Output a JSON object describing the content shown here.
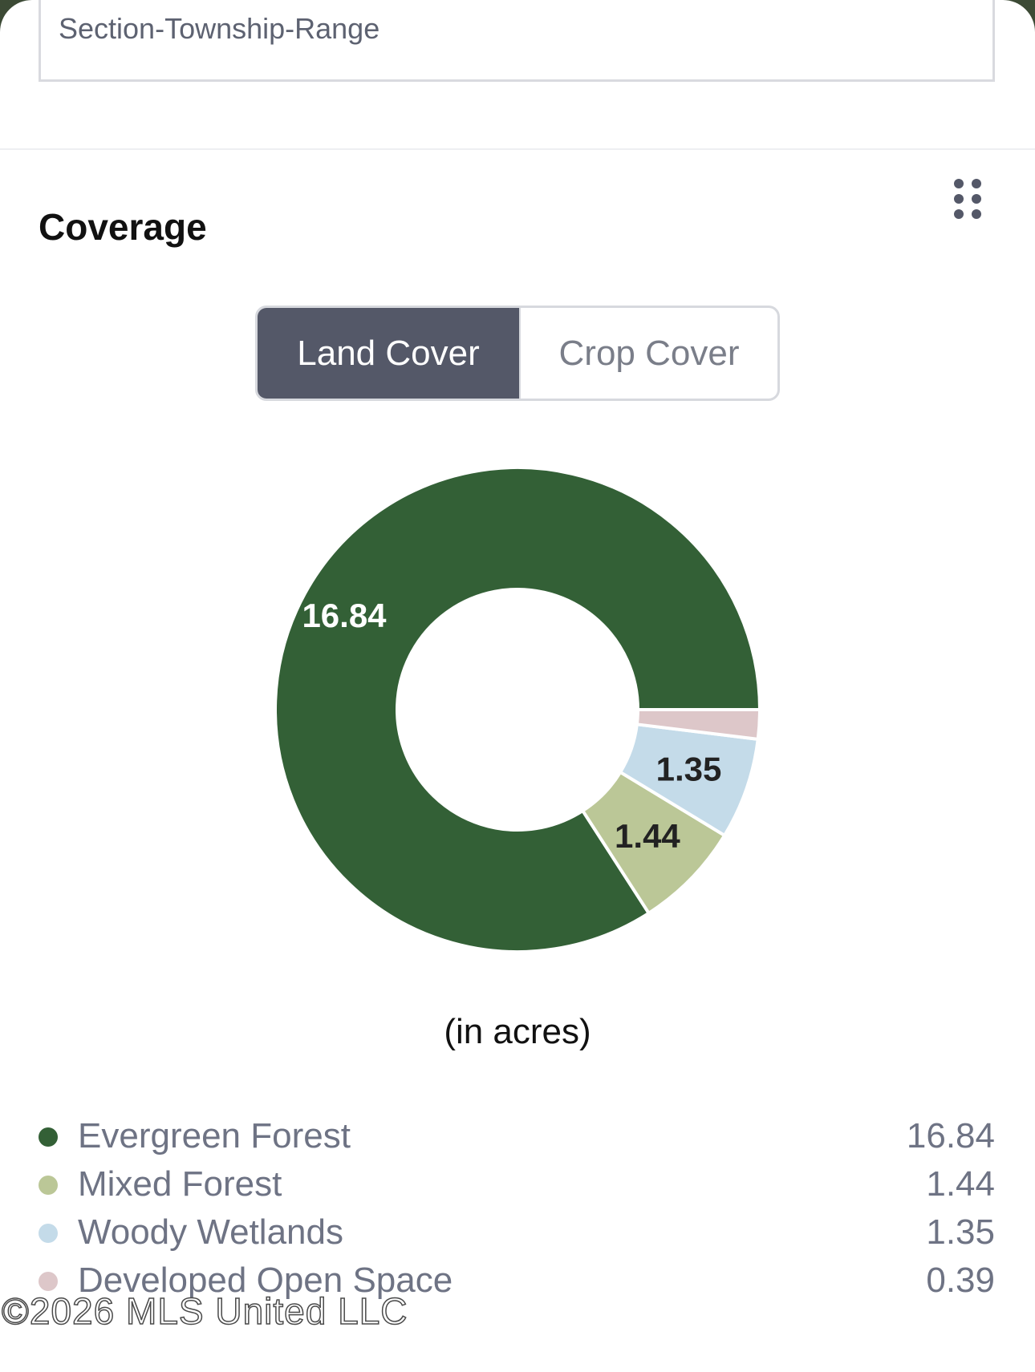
{
  "search": {
    "str_placeholder": "Section-Township-Range"
  },
  "coverage": {
    "title": "Coverage",
    "drag_icon": "drag-handle-icon",
    "tabs": [
      {
        "label": "Land Cover",
        "active": true
      },
      {
        "label": "Crop Cover",
        "active": false
      }
    ],
    "units_label": "(in acres)"
  },
  "chart_data": {
    "type": "pie",
    "categories": [
      "Evergreen Forest",
      "Mixed Forest",
      "Woody Wetlands",
      "Developed Open Space"
    ],
    "values": [
      16.84,
      1.44,
      1.35,
      0.39
    ],
    "colors": [
      "#336036",
      "#bbc797",
      "#c4dbe9",
      "#ddc7c9"
    ],
    "label_colors": [
      "#ffffff",
      "#222222",
      "#222222",
      "#222222"
    ],
    "data_labels": [
      "16.84",
      "1.44",
      "1.35",
      ""
    ],
    "donut": true
  },
  "legend": [
    {
      "label": "Evergreen Forest",
      "value": "16.84",
      "color": "#336036"
    },
    {
      "label": "Mixed Forest",
      "value": "1.44",
      "color": "#bbc797"
    },
    {
      "label": "Woody Wetlands",
      "value": "1.35",
      "color": "#c4dbe9"
    },
    {
      "label": "Developed Open Space",
      "value": "0.39",
      "color": "#ddc7c9"
    }
  ],
  "watermark": "©2026 MLS United LLC"
}
